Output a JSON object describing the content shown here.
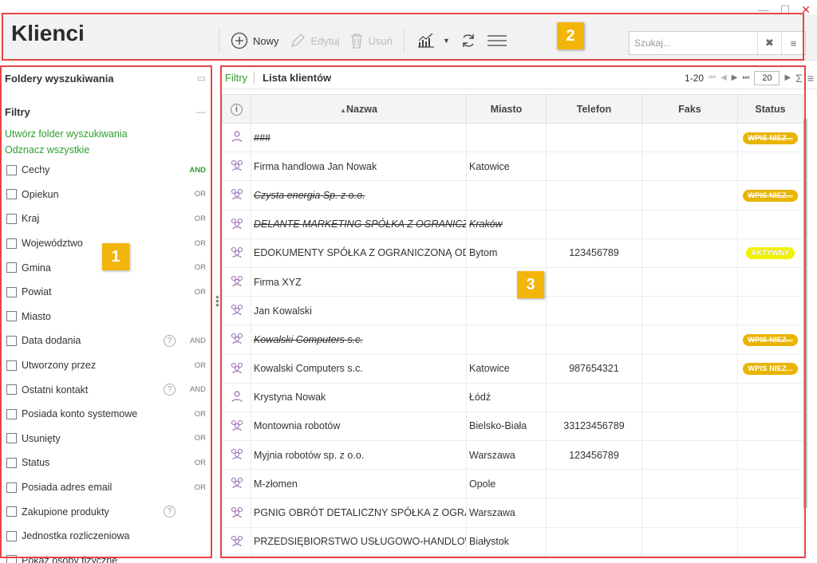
{
  "window": {
    "minimize": "—",
    "maximize": "☐",
    "close": "✕"
  },
  "header": {
    "title": "Klienci",
    "toolbar": {
      "new": "Nowy",
      "edit": "Edytuj",
      "delete": "Usuń"
    },
    "search_placeholder": "Szukaj..."
  },
  "sidebar": {
    "search_folders_title": "Foldery wyszukiwania",
    "filters_title": "Filtry",
    "create_folder_link": "Utwórz folder wyszukiwania",
    "uncheck_all_link": "Odznacz wszystkie",
    "filters": [
      {
        "label": "Cechy",
        "op": "AND",
        "op_green": true,
        "help": false
      },
      {
        "label": "Opiekun",
        "op": "OR",
        "help": false
      },
      {
        "label": "Kraj",
        "op": "OR",
        "help": false
      },
      {
        "label": "Województwo",
        "op": "OR",
        "help": false
      },
      {
        "label": "Gmina",
        "op": "OR",
        "help": false
      },
      {
        "label": "Powiat",
        "op": "OR",
        "help": false
      },
      {
        "label": "Miasto",
        "op": "",
        "help": false
      },
      {
        "label": "Data dodania",
        "op": "AND",
        "help": true
      },
      {
        "label": "Utworzony przez",
        "op": "OR",
        "help": false
      },
      {
        "label": "Ostatni kontakt",
        "op": "AND",
        "help": true
      },
      {
        "label": "Posiada konto systemowe",
        "op": "OR",
        "help": false
      },
      {
        "label": "Usunięty",
        "op": "OR",
        "help": false
      },
      {
        "label": "Status",
        "op": "OR",
        "help": false
      },
      {
        "label": "Posiada adres email",
        "op": "OR",
        "help": false
      },
      {
        "label": "Zakupione produkty",
        "op": "",
        "help": true
      },
      {
        "label": "Jednostka rozliczeniowa",
        "op": "",
        "help": false
      },
      {
        "label": "Pokaż osoby fizyczne",
        "op": "",
        "help": false
      }
    ],
    "help_glyph": "?"
  },
  "main": {
    "tab_filters": "Filtry",
    "tab_list": "Lista klientów",
    "pager": {
      "range": "1-20",
      "page_size": "20",
      "sum_glyph": "Σ"
    },
    "columns": [
      "Nazwa",
      "Miasto",
      "Telefon",
      "Faks",
      "Status"
    ],
    "sort_indicator": "▲",
    "rows": [
      {
        "icon": "person-icon",
        "name": "###",
        "city": "",
        "phone": "",
        "fax": "",
        "status": "WPIS NIEZ...",
        "deleted": true
      },
      {
        "icon": "group-icon",
        "name": "Firma handlowa Jan Nowak",
        "city": "Katowice",
        "phone": "",
        "fax": "",
        "status": "",
        "deleted": false
      },
      {
        "icon": "group-icon",
        "name": "Czysta energia Sp. z o.o.",
        "city": "",
        "phone": "",
        "fax": "",
        "status": "WPIS NIEZ...",
        "deleted": true
      },
      {
        "icon": "group-icon",
        "name": "DELANTE MARKETING SPÓŁKA Z OGRANICZO",
        "city": "Kraków",
        "phone": "",
        "fax": "",
        "status": "",
        "deleted": true
      },
      {
        "icon": "group-icon",
        "name": "EDOKUMENTY SPÓŁKA Z OGRANICZONĄ ODP",
        "city": "Bytom",
        "phone": "123456789",
        "fax": "",
        "status": "AKTYWNY",
        "deleted": false
      },
      {
        "icon": "group-icon",
        "name": "Firma XYZ",
        "city": "",
        "phone": "",
        "fax": "",
        "status": "",
        "deleted": false
      },
      {
        "icon": "group-icon",
        "name": "Jan Kowalski",
        "city": "",
        "phone": "",
        "fax": "",
        "status": "",
        "deleted": false
      },
      {
        "icon": "group-icon",
        "name": "Kowalski Computers s.c.",
        "city": "",
        "phone": "",
        "fax": "",
        "status": "WPIS NIEZ...",
        "deleted": true
      },
      {
        "icon": "group-icon",
        "name": "Kowalski Computers s.c.",
        "city": "Katowice",
        "phone": "987654321",
        "fax": "",
        "status": "WPIS NIEZ...",
        "deleted": false
      },
      {
        "icon": "person-icon",
        "name": "Krystyna Nowak",
        "city": "Łódź",
        "phone": "",
        "fax": "",
        "status": "",
        "deleted": false
      },
      {
        "icon": "group-icon",
        "name": "Montownia robotów",
        "city": "Bielsko-Biała",
        "phone": "33123456789",
        "fax": "",
        "status": "",
        "deleted": false
      },
      {
        "icon": "group-icon",
        "name": "Myjnia robotów sp. z o.o.",
        "city": "Warszawa",
        "phone": "123456789",
        "fax": "",
        "status": "",
        "deleted": false
      },
      {
        "icon": "group-icon",
        "name": "M-złomen",
        "city": "Opole",
        "phone": "",
        "fax": "",
        "status": "",
        "deleted": false
      },
      {
        "icon": "group-icon",
        "name": "PGNIG OBRÓT DETALICZNY SPÓŁKA Z OGRANI",
        "city": "Warszawa",
        "phone": "",
        "fax": "",
        "status": "",
        "deleted": false
      },
      {
        "icon": "group-icon",
        "name": "PRZEDSIĘBIORSTWO USŁUGOWO-HANDLOWE",
        "city": "Białystok",
        "phone": "",
        "fax": "",
        "status": "",
        "deleted": false
      }
    ]
  },
  "annotations": [
    "1",
    "2",
    "3"
  ],
  "colors": {
    "accent_green": "#2d9f2d",
    "badge_yellow": "#e8b400",
    "badge_active": "#f2f200",
    "annotation_red": "#e64545",
    "annotation_tag": "#f2b50a"
  }
}
